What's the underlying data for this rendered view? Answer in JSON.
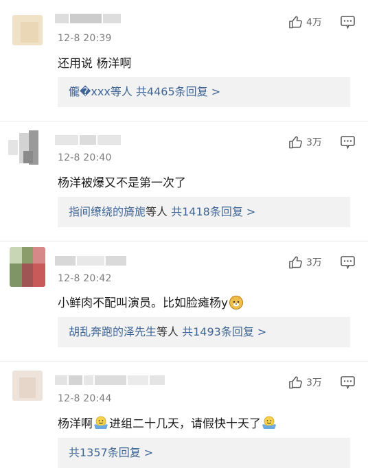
{
  "comments": [
    {
      "time": "12-8 20:39",
      "text": "还用说 杨洋啊",
      "likes": "4万",
      "reply_who": "儱�xxx等人",
      "reply_text": " 共4465条回复 >"
    },
    {
      "time": "12-8 20:40",
      "text": "杨洋被爆又不是第一次了",
      "likes": "3万",
      "reply_who": "指间缭绕的旖旎",
      "reply_mid": "等人",
      "reply_text": " 共1418条回复 >"
    },
    {
      "time": "12-8 20:42",
      "text": "小鲜肉不配叫演员。比如脸瘫杨y",
      "likes": "3万",
      "reply_who": "胡乱奔跑的泽先生",
      "reply_mid": "等人",
      "reply_text": " 共1493条回复 >"
    },
    {
      "time": "12-8 20:44",
      "text_a": "杨洋啊",
      "text_b": "进组二十几天，请假快十天了",
      "likes": "3万",
      "reply_text": "共1357条回复 >"
    }
  ],
  "icons": {
    "like": "thumbs-up-icon",
    "more": "more-icon",
    "emoji_dog": "doge-emoji",
    "emoji_shrug": "shrug-emoji"
  },
  "colors": {
    "link": "#3f6596",
    "reply_bg": "#f2f2f2",
    "time": "#7d7d7d"
  }
}
